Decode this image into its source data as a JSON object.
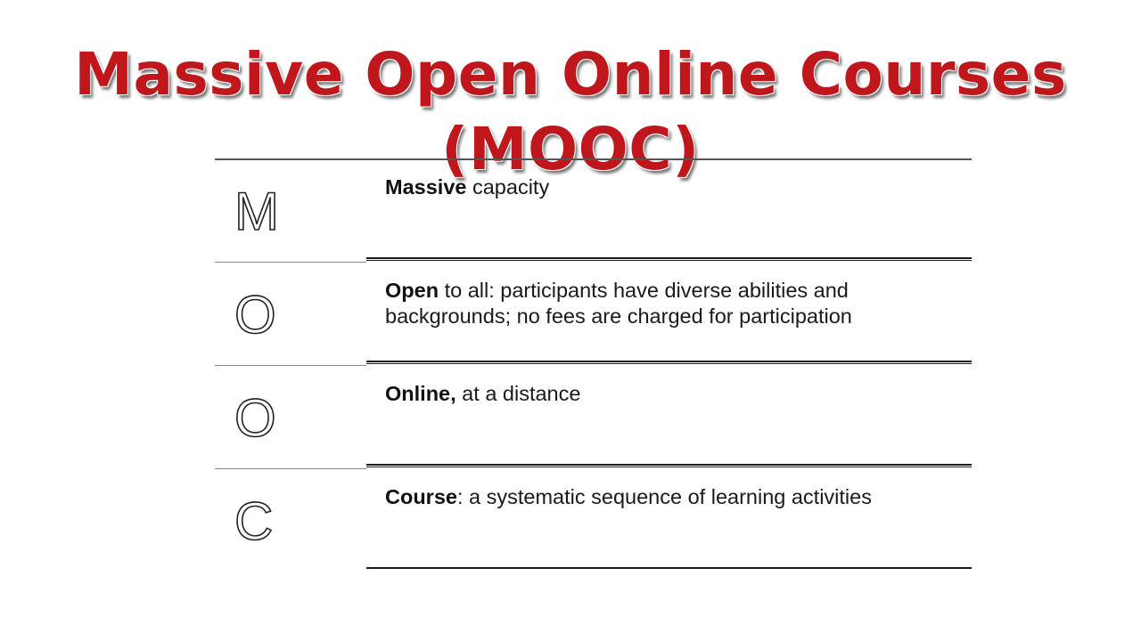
{
  "slide": {
    "title": "Massive Open Online Courses (MOOC)"
  },
  "rows": [
    {
      "letter": "M",
      "term": "Massive",
      "rest": " capacity"
    },
    {
      "letter": "O",
      "term": "Open",
      "rest": " to all: participants have diverse abilities and backgrounds; no fees are charged for participation"
    },
    {
      "letter": "O",
      "term": "Online,",
      "rest": " at a distance"
    },
    {
      "letter": "C",
      "term": "Course",
      "rest": ": a systematic sequence of learning activities"
    }
  ],
  "colors": {
    "title": "#c0171c",
    "text": "#1a1a1a",
    "rule": "#1a1a1a"
  }
}
